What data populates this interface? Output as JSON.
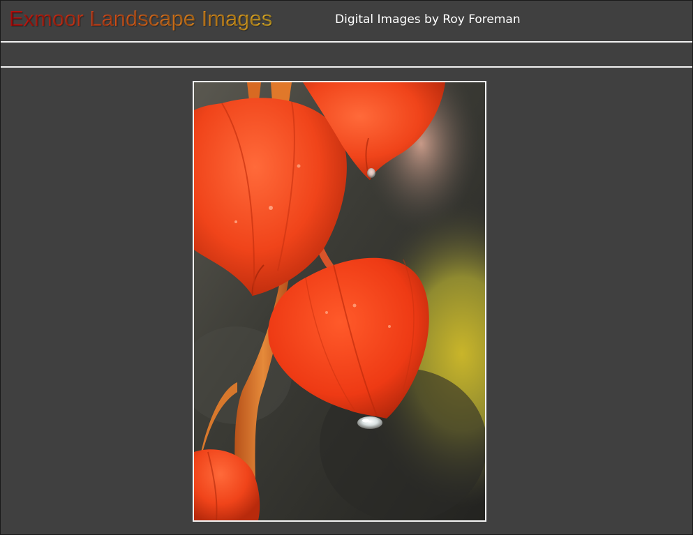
{
  "header": {
    "site_title": "Exmoor Landscape Images",
    "subtitle": "Digital Images by Roy Foreman"
  },
  "photo": {
    "subject": "chinese-lantern-flower-photo",
    "colors": {
      "page_background": "#404040",
      "frame_border": "#f5f5f5",
      "lantern_red": "#f04a1a",
      "stem_orange": "#d86a22",
      "bokeh_yellow": "#c8b42a"
    }
  }
}
